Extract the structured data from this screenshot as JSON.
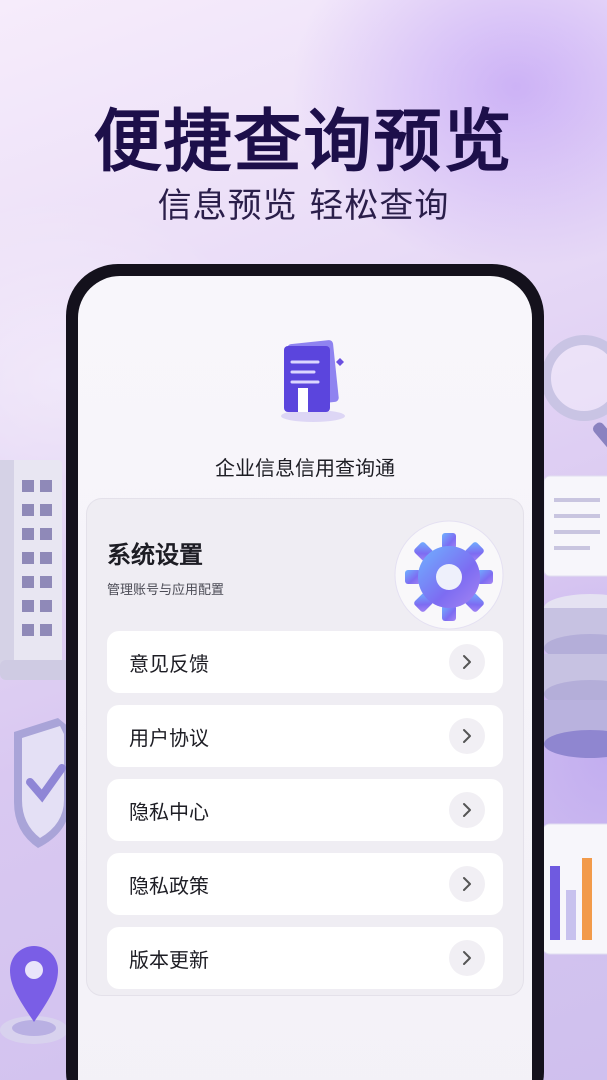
{
  "promo": {
    "headline": "便捷查询预览",
    "subline": "信息预览 轻松查询"
  },
  "app": {
    "name": "企业信息信用查询通",
    "logo_icon": "document-logo-icon"
  },
  "settings": {
    "title": "系统设置",
    "subtitle": "管理账号与应用配置",
    "illustration_icon": "gear-icon",
    "items": [
      {
        "label": "意见反馈",
        "icon": "chevron-right-icon"
      },
      {
        "label": "用户协议",
        "icon": "chevron-right-icon"
      },
      {
        "label": "隐私中心",
        "icon": "chevron-right-icon"
      },
      {
        "label": "隐私政策",
        "icon": "chevron-right-icon"
      },
      {
        "label": "版本更新",
        "icon": "chevron-right-icon"
      }
    ]
  },
  "colors": {
    "accent": "#6b4fe0",
    "headline": "#1d0f4a",
    "background": "#e9dcf7"
  }
}
